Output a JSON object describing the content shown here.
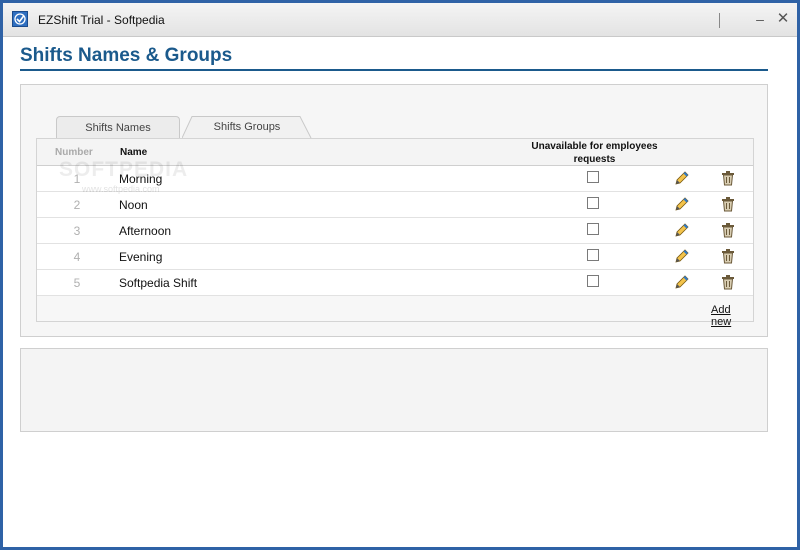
{
  "window": {
    "title": "EZShift Trial - Softpedia",
    "minimize_glyph": "–",
    "close_glyph": "✕"
  },
  "page": {
    "title": "Shifts Names & Groups"
  },
  "tabs": [
    {
      "label": "Shifts Names"
    },
    {
      "label": "Shifts Groups"
    }
  ],
  "table": {
    "headers": {
      "number": "Number",
      "name": "Name",
      "unavailable": "Unavailable for employees requests"
    },
    "rows": [
      {
        "number": "1",
        "name": "Morning",
        "unavailable": false
      },
      {
        "number": "2",
        "name": "Noon",
        "unavailable": false
      },
      {
        "number": "3",
        "name": "Afternoon",
        "unavailable": false
      },
      {
        "number": "4",
        "name": "Evening",
        "unavailable": false
      },
      {
        "number": "5",
        "name": "Softpedia Shift",
        "unavailable": false
      }
    ],
    "add_new_label": "Add new"
  },
  "watermark": {
    "text": "SOFTPEDIA",
    "sub": "www.softpedia.com"
  },
  "icons": {
    "app": "ezshift-app-icon",
    "edit": "pencil-icon",
    "delete": "trash-icon"
  },
  "colors": {
    "title": "#1b5a8c",
    "window_frame": "#2f62a6"
  }
}
